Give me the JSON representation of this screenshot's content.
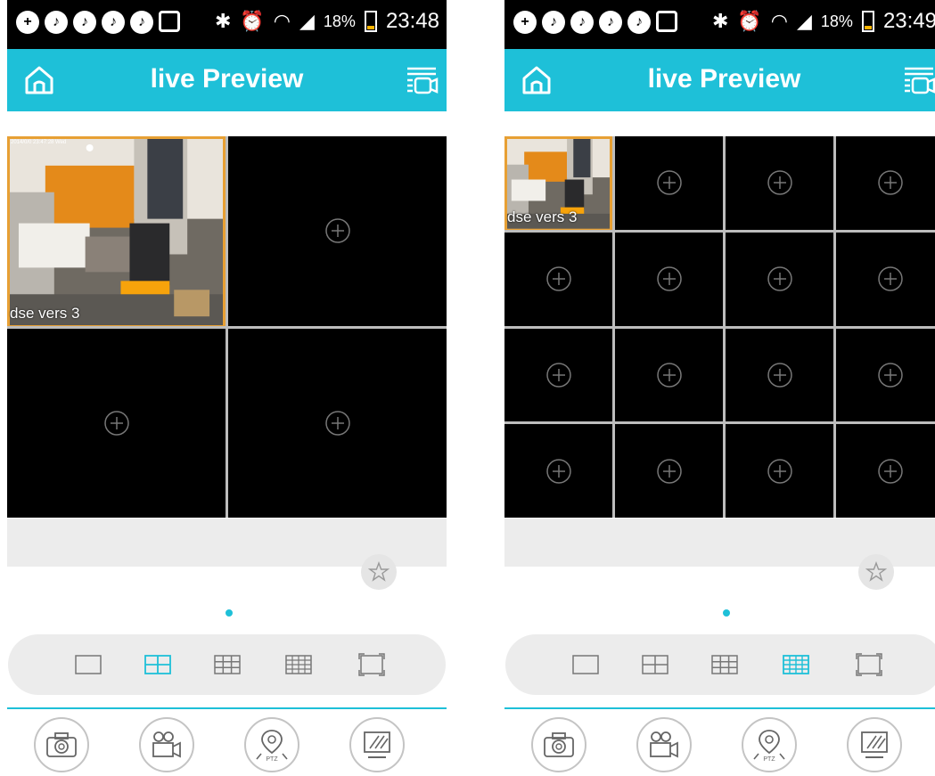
{
  "screens": [
    {
      "status": {
        "battery": "18%",
        "time": "23:48"
      },
      "header": {
        "title": "live Preview"
      },
      "layout": {
        "columns": 2,
        "rows": 2,
        "selected": "four-split"
      },
      "channels": [
        {
          "label": "dse vers 3",
          "osd": "2014/0/0 23:47:28 Wed",
          "active": true
        },
        {
          "label": "",
          "active": false
        },
        {
          "label": "",
          "active": false
        },
        {
          "label": "",
          "active": false
        }
      ]
    },
    {
      "status": {
        "battery": "18%",
        "time": "23:49"
      },
      "header": {
        "title": "live Preview"
      },
      "layout": {
        "columns": 4,
        "rows": 4,
        "selected": "sixteen-split"
      },
      "channels": [
        {
          "label": "dse vers 3",
          "active": true
        },
        {
          "label": ""
        },
        {
          "label": ""
        },
        {
          "label": ""
        },
        {
          "label": ""
        },
        {
          "label": ""
        },
        {
          "label": ""
        },
        {
          "label": ""
        },
        {
          "label": ""
        },
        {
          "label": ""
        },
        {
          "label": ""
        },
        {
          "label": ""
        },
        {
          "label": ""
        },
        {
          "label": ""
        },
        {
          "label": ""
        },
        {
          "label": ""
        }
      ]
    }
  ],
  "layout_options": [
    "single-view",
    "four-split",
    "nine-split",
    "sixteen-split",
    "fullscreen"
  ],
  "toolbar": [
    "snapshot",
    "record",
    "ptz",
    "image-adjust"
  ],
  "ptz_label": "PTZ",
  "icons": {
    "home": "home-icon",
    "camera_list": "camera-list-icon",
    "favorite": "favorite-star-icon",
    "add_channel": "plus-circle-icon"
  },
  "colors": {
    "accent": "#1ec0d8",
    "active_border": "#e7a034",
    "status_bar": "#000000",
    "grid_bg": "#000000"
  }
}
